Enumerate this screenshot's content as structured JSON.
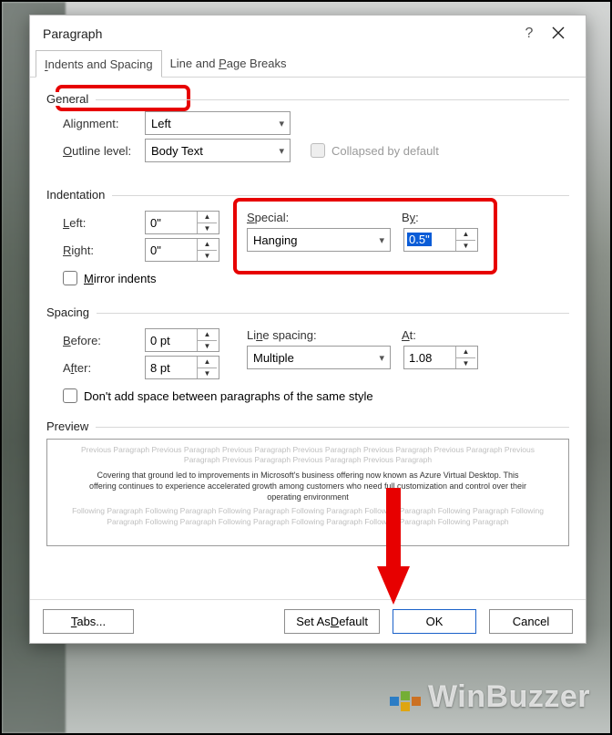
{
  "window": {
    "title": "Paragraph"
  },
  "tabs": {
    "indents": "Indents and Spacing",
    "breaks": "Line and Page Breaks"
  },
  "general": {
    "heading": "General",
    "alignment_label": "Alignment:",
    "alignment_value": "Left",
    "outline_label": "Outline level:",
    "outline_value": "Body Text",
    "collapsed_label": "Collapsed by default"
  },
  "indent": {
    "heading": "Indentation",
    "left_label": "Left:",
    "left_value": "0\"",
    "right_label": "Right:",
    "right_value": "0\"",
    "special_label": "Special:",
    "special_value": "Hanging",
    "by_label": "By:",
    "by_value": "0.5\"",
    "mirror_label": "Mirror indents"
  },
  "spacing": {
    "heading": "Spacing",
    "before_label": "Before:",
    "before_value": "0 pt",
    "after_label": "After:",
    "after_value": "8 pt",
    "line_label": "Line spacing:",
    "line_value": "Multiple",
    "at_label": "At:",
    "at_value": "1.08",
    "nodup_label": "Don't add space between paragraphs of the same style"
  },
  "preview": {
    "heading": "Preview",
    "prev_text": "Previous Paragraph Previous Paragraph Previous Paragraph Previous Paragraph Previous Paragraph Previous Paragraph Previous Paragraph Previous Paragraph Previous Paragraph Previous Paragraph",
    "sample_text": "Covering that ground led to improvements in Microsoft's business offering now known as Azure Virtual Desktop. This offering continues to experience accelerated growth among customers who need full customization and control over their operating environment",
    "next_text": "Following Paragraph Following Paragraph Following Paragraph Following Paragraph Following Paragraph Following Paragraph Following Paragraph Following Paragraph Following Paragraph Following Paragraph Following Paragraph Following Paragraph"
  },
  "buttons": {
    "tabs": "Tabs...",
    "default": "Set As Default",
    "ok": "OK",
    "cancel": "Cancel"
  },
  "watermark": "WinBuzzer"
}
